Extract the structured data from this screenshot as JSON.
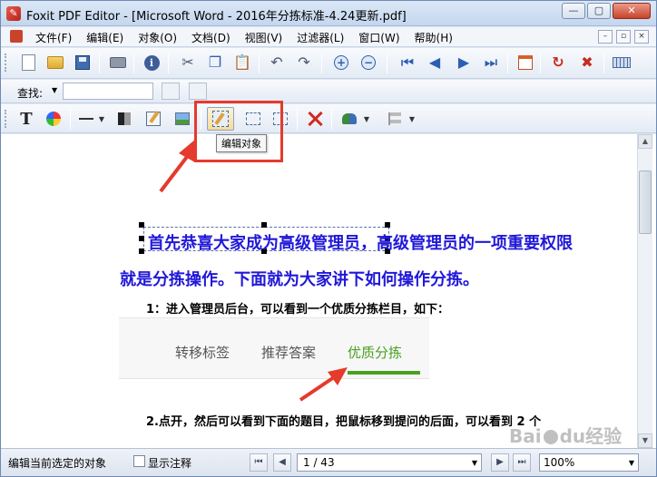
{
  "window": {
    "title": "Foxit PDF Editor - [Microsoft Word - 2016年分拣标准-4.24更新.pdf]"
  },
  "window_controls": {
    "minimize": "—",
    "maximize": "▢",
    "close": "✕"
  },
  "menu": {
    "items": [
      "文件(F)",
      "编辑(E)",
      "对象(O)",
      "文档(D)",
      "视图(V)",
      "过滤器(L)",
      "窗口(W)",
      "帮助(H)"
    ],
    "right_controls": [
      "–",
      "▫",
      "×"
    ]
  },
  "find_bar": {
    "label": "查找:",
    "input_value": ""
  },
  "tooltip": {
    "text": "编辑对象"
  },
  "document": {
    "heading_line1": "首先恭喜大家成为高级管理员，高级管理员的一项重要权限",
    "heading_line2": "就是分拣操作。下面就为大家讲下如何操作分拣。",
    "step1": "1：进入管理员后台，可以看到一个优质分拣栏目，如下：",
    "step2": "2.点开，然后可以看到下面的题目，把鼠标移到提问的后面，可以看到 2 个",
    "embedded_tabs": [
      "转移标签",
      "推荐答案",
      "优质分拣"
    ],
    "embedded_active_tab": "优质分拣"
  },
  "watermark": {
    "text_left": "Bai",
    "text_right": "du经验"
  },
  "statusbar": {
    "status_text": "编辑当前选定的对象",
    "show_annotations_label": "显示注释",
    "show_annotations_checked": false,
    "page_indicator": "1 / 43",
    "zoom": "100%"
  },
  "colors": {
    "heading_blue": "#2018d8",
    "highlight_red": "#e53a2c",
    "active_tab_green": "#4aa020"
  },
  "icons": {
    "toolbar1": [
      "new-document-icon",
      "open-folder-icon",
      "save-icon",
      "print-icon",
      "properties-icon",
      "cut-icon",
      "copy-icon",
      "paste-icon",
      "undo-icon",
      "redo-icon",
      "zoom-in-icon",
      "zoom-out-icon",
      "first-page-icon",
      "previous-page-icon",
      "next-page-icon",
      "last-page-icon",
      "calendar-icon",
      "rotate-icon",
      "delete-page-icon",
      "keyboard-icon"
    ],
    "toolbar3": [
      "text-tool-icon",
      "color-tool-icon",
      "line-tool-icon",
      "shape-tool-icon",
      "edit-text-icon",
      "image-tool-icon",
      "edit-object-icon",
      "select-object-icon",
      "resize-object-icon",
      "delete-object-icon",
      "group-icon",
      "align-icon"
    ]
  }
}
